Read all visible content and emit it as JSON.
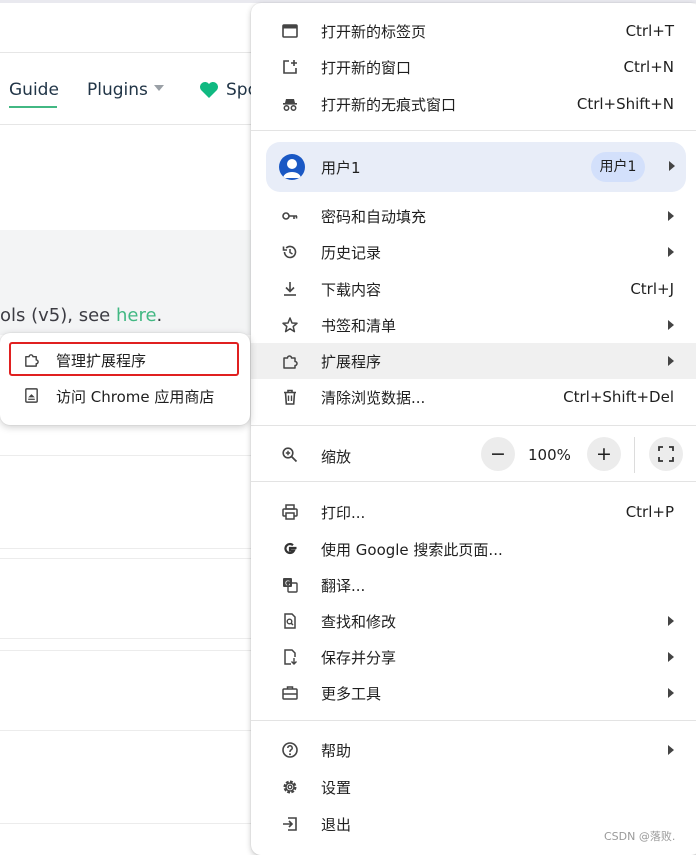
{
  "background_page": {
    "nav": {
      "guide": "Guide",
      "plugins": "Plugins",
      "spo": "Spo"
    },
    "text_prefix": "ols (v5), see ",
    "text_link": "here",
    "text_suffix": "."
  },
  "menu": {
    "new_tab": {
      "label": "打开新的标签页",
      "shortcut": "Ctrl+T"
    },
    "new_window": {
      "label": "打开新的窗口",
      "shortcut": "Ctrl+N"
    },
    "new_incognito": {
      "label": "打开新的无痕式窗口",
      "shortcut": "Ctrl+Shift+N"
    },
    "profile": {
      "label": "用户1",
      "chip": "用户1"
    },
    "passwords": {
      "label": "密码和自动填充"
    },
    "history": {
      "label": "历史记录"
    },
    "downloads": {
      "label": "下载内容",
      "shortcut": "Ctrl+J"
    },
    "bookmarks": {
      "label": "书签和清单"
    },
    "extensions": {
      "label": "扩展程序"
    },
    "clear_data": {
      "label": "清除浏览数据...",
      "shortcut": "Ctrl+Shift+Del"
    },
    "zoom": {
      "label": "缩放",
      "minus": "−",
      "value": "100%",
      "plus": "+"
    },
    "print": {
      "label": "打印...",
      "shortcut": "Ctrl+P"
    },
    "search_google": {
      "label": "使用 Google 搜索此页面..."
    },
    "translate": {
      "label": "翻译..."
    },
    "find": {
      "label": "查找和修改"
    },
    "save_share": {
      "label": "保存并分享"
    },
    "more_tools": {
      "label": "更多工具"
    },
    "help": {
      "label": "帮助"
    },
    "settings": {
      "label": "设置"
    },
    "exit": {
      "label": "退出"
    }
  },
  "submenu": {
    "manage_extensions": "管理扩展程序",
    "visit_store": "访问 Chrome 应用商店"
  },
  "watermark": "CSDN @落败.",
  "colors": {
    "accent_green": "#42b883",
    "highlight_red": "#e02020",
    "profile_bg": "#e8edf8",
    "avatar_blue": "#1a58c4"
  }
}
